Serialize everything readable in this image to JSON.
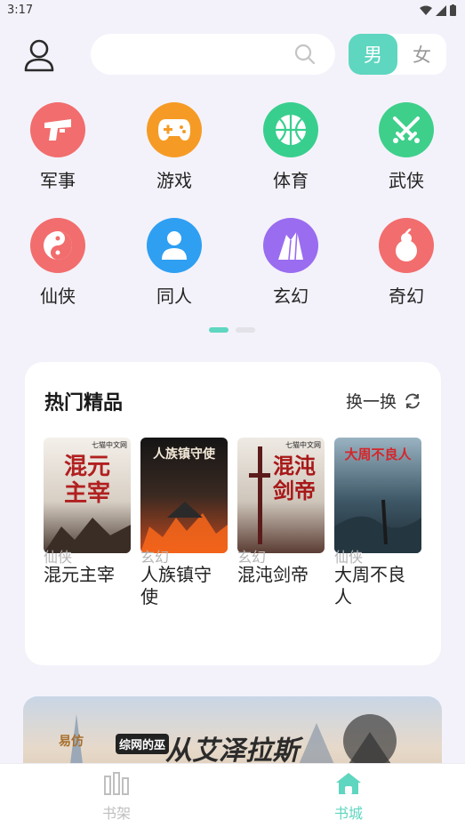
{
  "status": {
    "time": "3:17"
  },
  "gender": {
    "male": "男",
    "female": "女"
  },
  "categories": [
    {
      "label": "军事",
      "color": "#f26d6d",
      "icon": "gun-icon"
    },
    {
      "label": "游戏",
      "color": "#f59b25",
      "icon": "gamepad-icon"
    },
    {
      "label": "体育",
      "color": "#38cf8e",
      "icon": "basketball-icon"
    },
    {
      "label": "武侠",
      "color": "#3ecf8b",
      "icon": "crossed-swords-icon"
    },
    {
      "label": "仙侠",
      "color": "#f26d6d",
      "icon": "yin-yang-icon"
    },
    {
      "label": "同人",
      "color": "#2f9ff2",
      "icon": "person-icon"
    },
    {
      "label": "玄幻",
      "color": "#9a6cf0",
      "icon": "crystal-icon"
    },
    {
      "label": "奇幻",
      "color": "#f26d6d",
      "icon": "gourd-icon"
    }
  ],
  "hot": {
    "title": "热门精品",
    "refresh_label": "换一换",
    "books": [
      {
        "title": "混元主宰",
        "category": "仙侠"
      },
      {
        "title": "人族镇守使",
        "category": "玄幻"
      },
      {
        "title": "混沌剑帝",
        "category": "玄幻"
      },
      {
        "title": "大周不良人",
        "category": "仙侠"
      }
    ]
  },
  "banner": {
    "text": "从艾泽拉斯",
    "sub": "综网的巫",
    "tag": "易仿"
  },
  "tabs": {
    "shelf": "书架",
    "store": "书城"
  },
  "colors": {
    "accent": "#5fd6c0",
    "background": "#f3f2fa"
  }
}
